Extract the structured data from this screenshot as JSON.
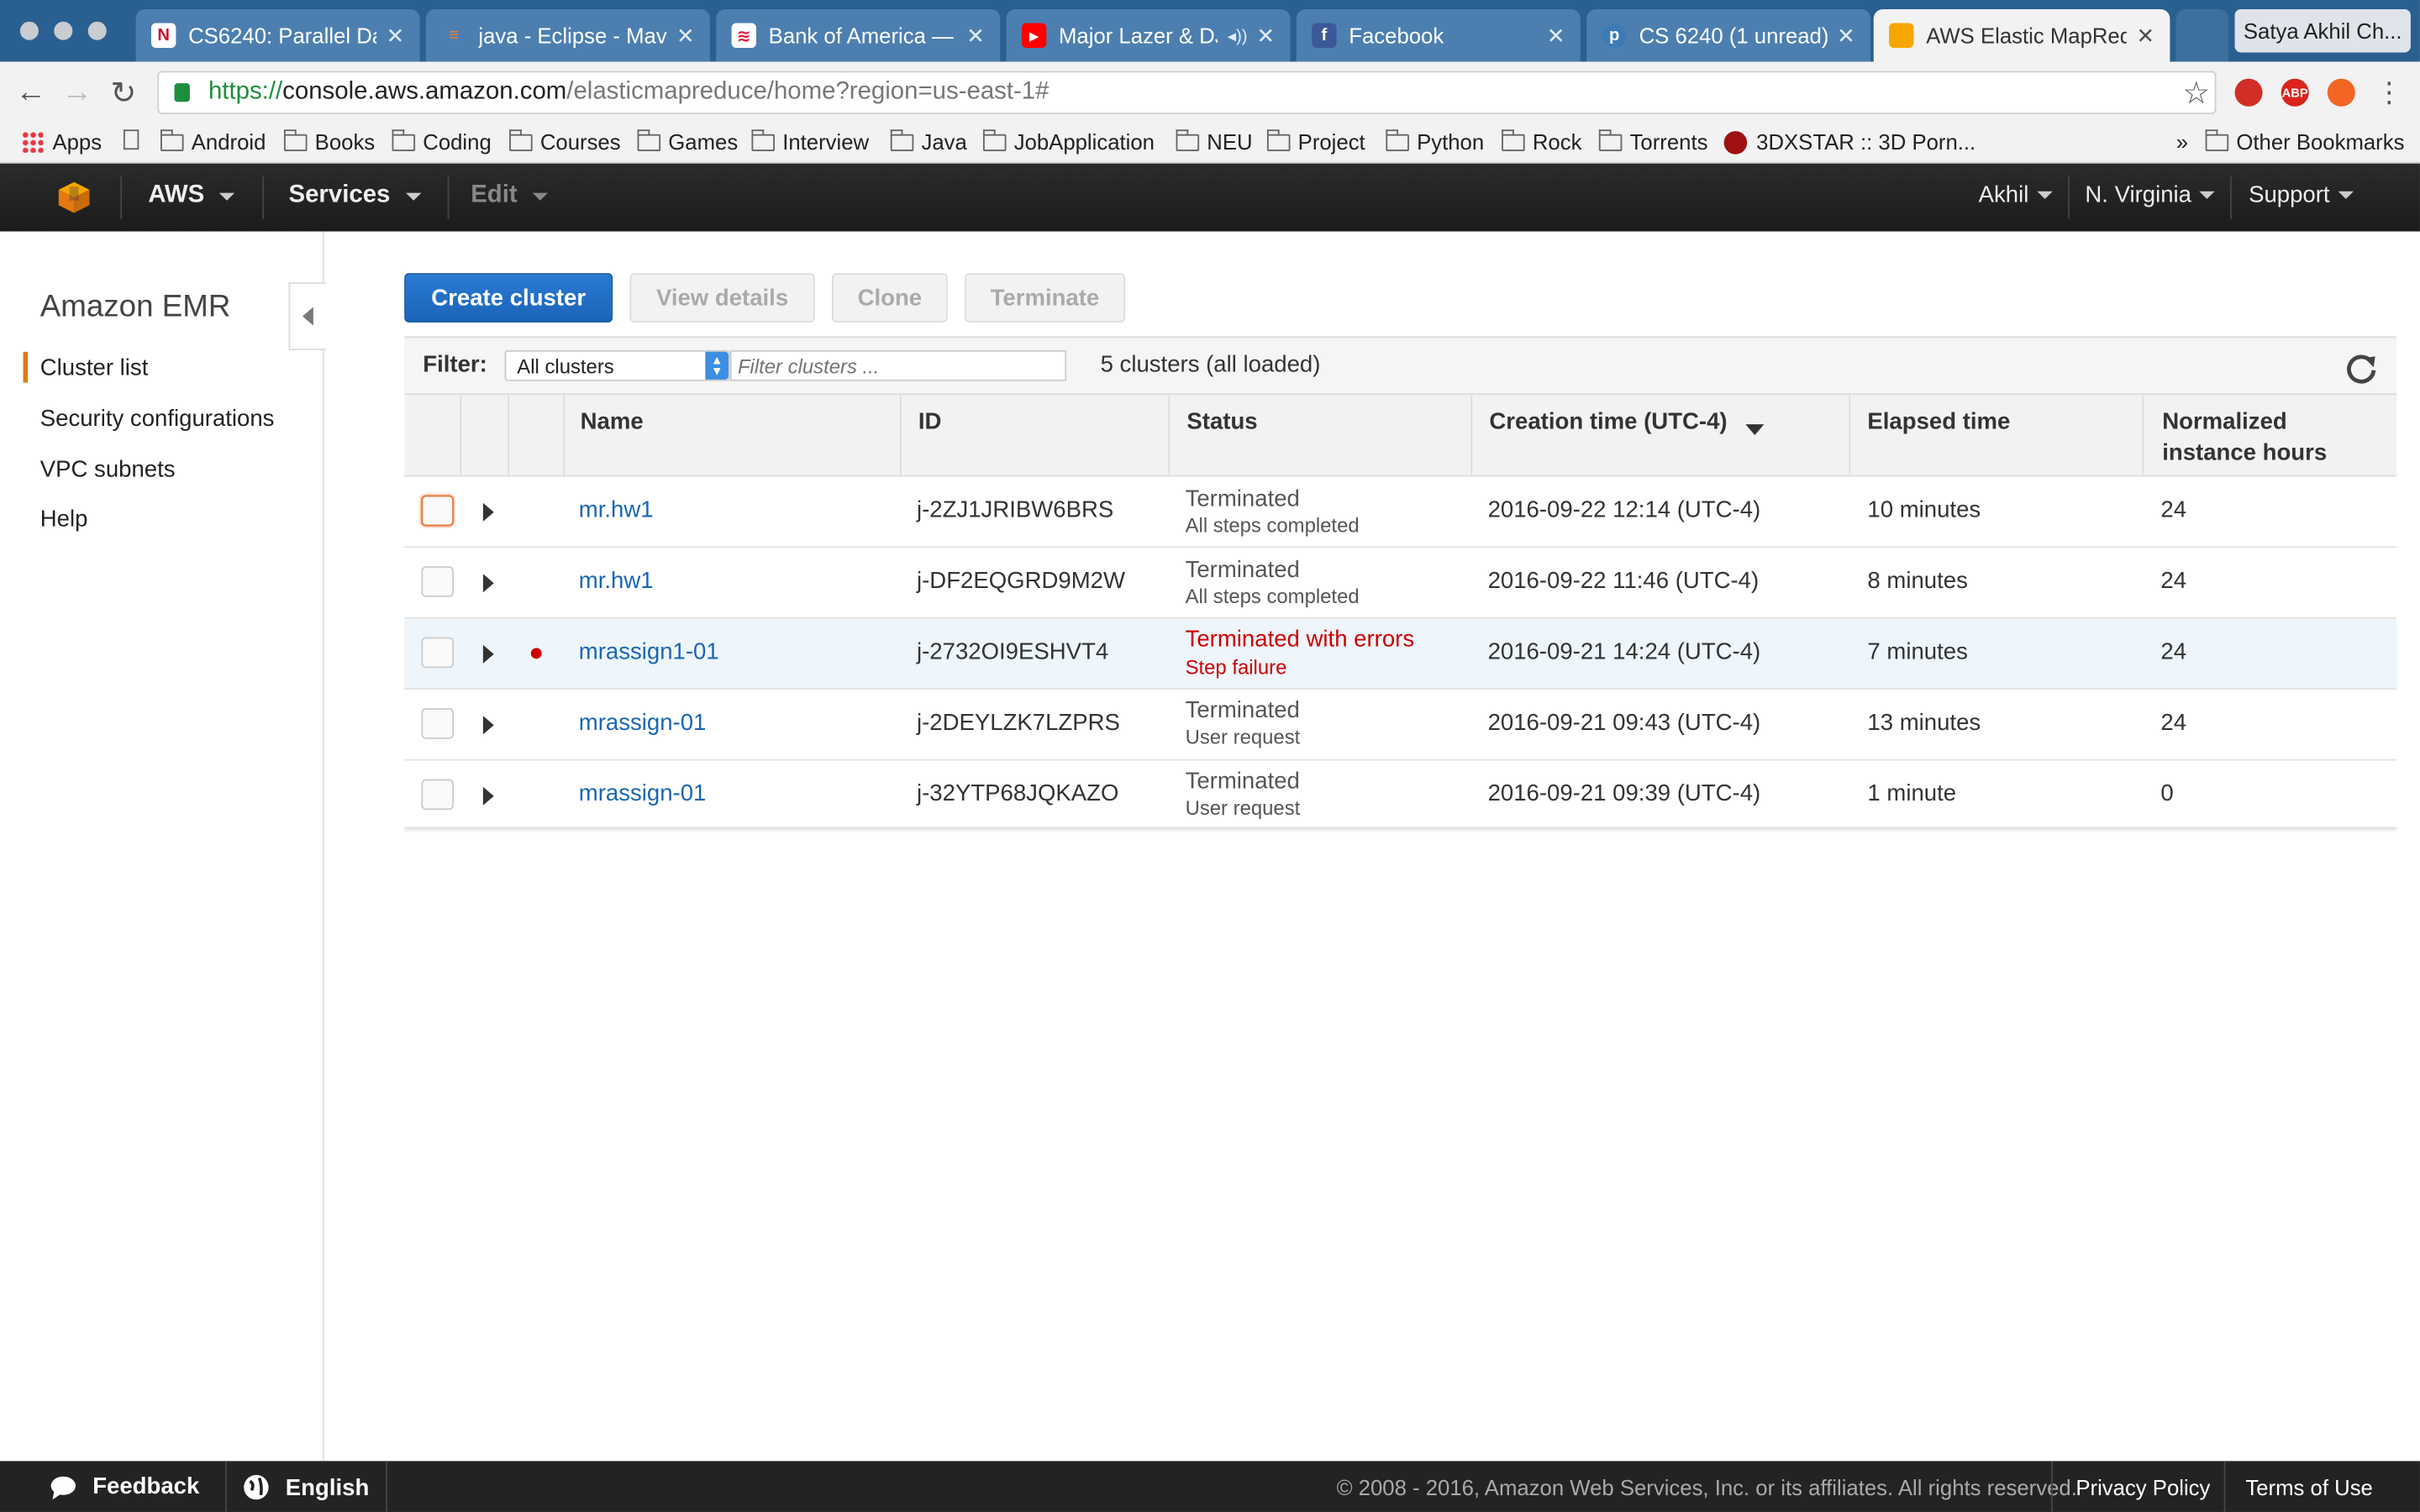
{
  "browser": {
    "tabs": [
      {
        "title": "CS6240: Parallel Dat",
        "icon": "northeastern-favicon",
        "color": "#c8102e"
      },
      {
        "title": "java - Eclipse - Mave",
        "icon": "stackoverflow-favicon",
        "color": "#f48024"
      },
      {
        "title": "Bank of America — B",
        "icon": "bofa-favicon",
        "color": "#e31837"
      },
      {
        "title": "Major Lazer & DJ",
        "icon": "youtube-favicon",
        "color": "#ff0000"
      },
      {
        "title": "Facebook",
        "icon": "facebook-favicon",
        "color": "#3b5998"
      },
      {
        "title": "CS 6240 (1 unread)",
        "icon": "piazza-favicon",
        "color": "#3e7ab3"
      },
      {
        "title": "AWS Elastic MapRed",
        "icon": "aws-favicon",
        "color": "#f7a600"
      }
    ],
    "profile_name": "Satya Akhil Ch...",
    "url": {
      "scheme": "https://",
      "host": "console.aws.amazon.com",
      "path": "/elasticmapreduce/home?region=us-east-1#"
    },
    "extensions": [
      {
        "icon": "lastpass-icon",
        "color": "#d32d27",
        "label": ""
      },
      {
        "icon": "adblock-plus-icon",
        "color": "#d9231c",
        "label": "ABP"
      },
      {
        "icon": "extension-orange-icon",
        "color": "#f26522",
        "label": ""
      }
    ],
    "bookmarks": [
      "Apps",
      "Android",
      "Books",
      "Coding",
      "Courses",
      "Games",
      "Interview",
      "Java",
      "JobApplication",
      "NEU",
      "Project",
      "Python",
      "Rock",
      "Torrents",
      "3DXSTAR :: 3D Porn...",
      "Other Bookmarks"
    ],
    "bookmarks_overflow": "»"
  },
  "aws_nav": {
    "brand": "AWS",
    "services": "Services",
    "edit": "Edit",
    "user": "Akhil",
    "region": "N. Virginia",
    "support": "Support",
    "brand_color": "#f90"
  },
  "sidebar": {
    "title": "Amazon EMR",
    "items": [
      "Cluster list",
      "Security configurations",
      "VPC subnets",
      "Help"
    ],
    "active_color": "#e07b00"
  },
  "actions": {
    "create": "Create cluster",
    "view_details": "View details",
    "clone": "Clone",
    "terminate": "Terminate"
  },
  "filter": {
    "label": "Filter:",
    "selected": "All clusters",
    "placeholder": "Filter clusters ...",
    "count_text": "5 clusters (all loaded)"
  },
  "table": {
    "headers": {
      "name": "Name",
      "id": "ID",
      "status": "Status",
      "creation": "Creation time (UTC-4)",
      "elapsed": "Elapsed time",
      "hours_1": "Normalized",
      "hours_2": "instance hours"
    },
    "rows": [
      {
        "name": "mr.hw1",
        "id": "j-2ZJ1JRIBW6BRS",
        "status": "Terminated",
        "status_detail": "All steps completed",
        "error": false,
        "creation": "2016-09-22 12:14 (UTC-4)",
        "elapsed": "10 minutes",
        "hours": "24"
      },
      {
        "name": "mr.hw1",
        "id": "j-DF2EQGRD9M2W",
        "status": "Terminated",
        "status_detail": "All steps completed",
        "error": false,
        "creation": "2016-09-22 11:46 (UTC-4)",
        "elapsed": "8 minutes",
        "hours": "24"
      },
      {
        "name": "mrassign1-01",
        "id": "j-2732OI9ESHVT4",
        "status": "Terminated with errors",
        "status_detail": "Step failure",
        "error": true,
        "creation": "2016-09-21 14:24 (UTC-4)",
        "elapsed": "7 minutes",
        "hours": "24"
      },
      {
        "name": "mrassign-01",
        "id": "j-2DEYLZK7LZPRS",
        "status": "Terminated",
        "status_detail": "User request",
        "error": false,
        "creation": "2016-09-21 09:43 (UTC-4)",
        "elapsed": "13 minutes",
        "hours": "24"
      },
      {
        "name": "mrassign-01",
        "id": "j-32YTP68JQKAZO",
        "status": "Terminated",
        "status_detail": "User request",
        "error": false,
        "creation": "2016-09-21 09:39 (UTC-4)",
        "elapsed": "1 minute",
        "hours": "0"
      }
    ]
  },
  "footer": {
    "feedback": "Feedback",
    "language": "English",
    "copyright": "© 2008 - 2016, Amazon Web Services, Inc. or its affiliates. All rights reserved.",
    "privacy": "Privacy Policy",
    "terms": "Terms of Use"
  }
}
